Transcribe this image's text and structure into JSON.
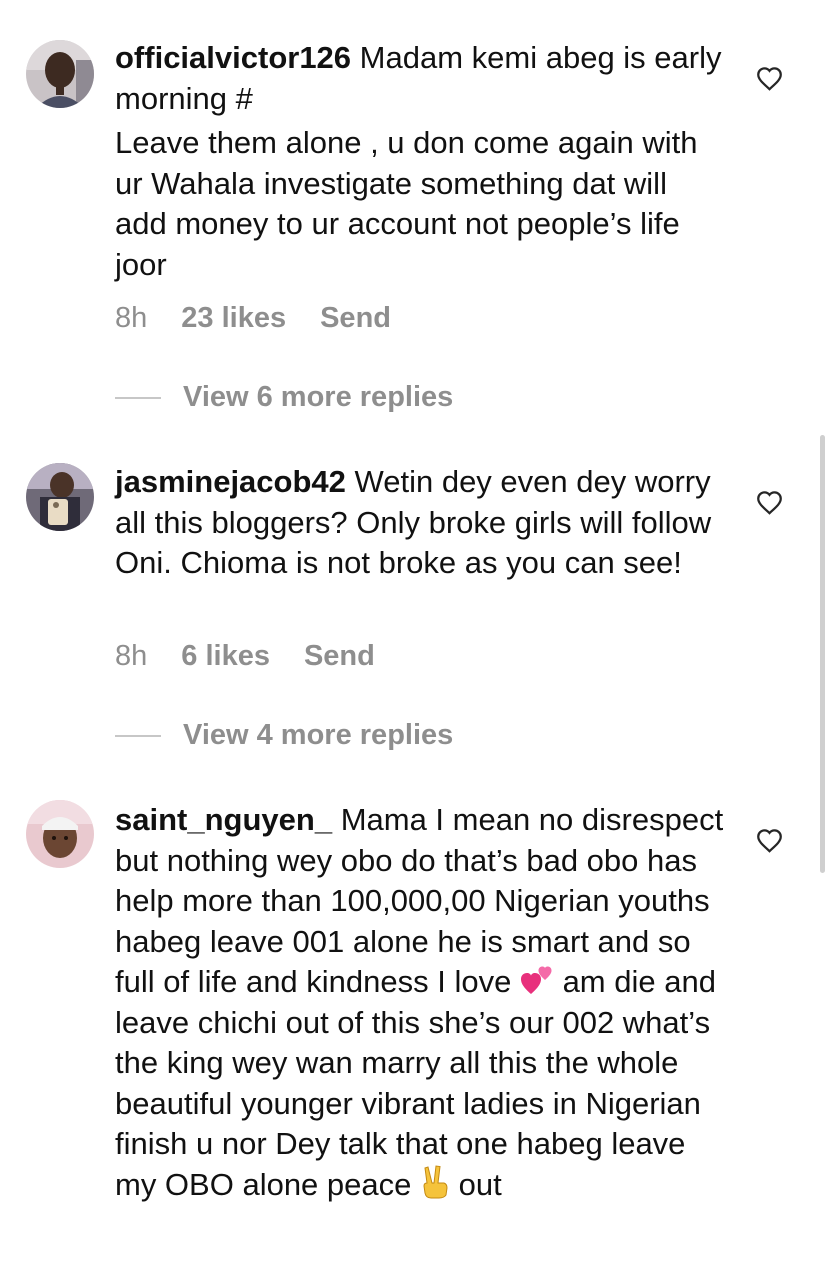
{
  "comments": [
    {
      "username": "officialvictor126",
      "text_first": "Madam kemi abeg is early morning #",
      "text_second": " Leave them alone , u don come again with ur Wahala investigate something dat will add money to ur account not people’s life joor",
      "time": "8h",
      "likes": "23 likes",
      "send": "Send",
      "avatar_icon": "profile-photo",
      "like_icon": "heart-outline-icon",
      "view_replies": "View 6 more replies"
    },
    {
      "username": "jasminejacob42",
      "text": "Wetin dey even dey worry all this bloggers? Only broke girls will follow Oni. Chioma is not broke as you can see!",
      "time": "8h",
      "likes": "6 likes",
      "send": "Send",
      "avatar_icon": "profile-photo",
      "like_icon": "heart-outline-icon",
      "view_replies": "View 4 more replies"
    },
    {
      "username": "saint_nguyen_",
      "text_part1": "Mama I mean no disrespect but nothing wey obo do that’s bad obo has help more than 100,000,00 Nigerian youths habeg leave 001 alone he is smart and so full of life and kindness I love ",
      "emoji1": "two-hearts-emoji",
      "text_part2": " am die and leave chichi out of this she’s our 002 what’s the king wey wan marry all this the whole beautiful younger vibrant ladies in Nigerian finish u nor Dey talk that one habeg leave my OBO alone peace ",
      "emoji2": "victory-hand-emoji",
      "text_part3": " out",
      "avatar_icon": "profile-photo",
      "like_icon": "heart-outline-icon"
    }
  ],
  "colors": {
    "text": "#111111",
    "secondary": "#8e8e8e",
    "divider": "#c7c7c7",
    "scrollbar": "#cfcfcf"
  }
}
